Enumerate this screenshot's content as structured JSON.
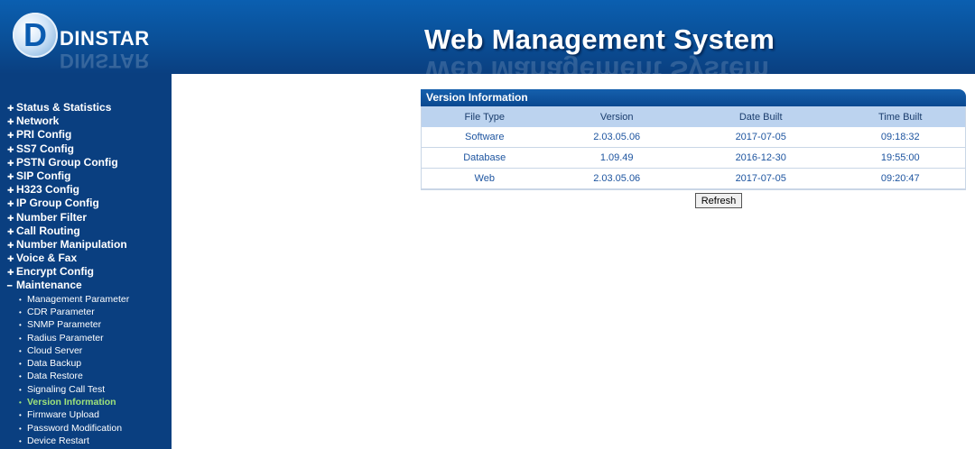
{
  "header": {
    "brand": "DINSTAR",
    "logo_letter": "D",
    "system_title": "Web Management System"
  },
  "sidebar": {
    "items": [
      {
        "label": "Status & Statistics"
      },
      {
        "label": "Network"
      },
      {
        "label": "PRI Config"
      },
      {
        "label": "SS7 Config"
      },
      {
        "label": "PSTN Group Config"
      },
      {
        "label": "SIP Config"
      },
      {
        "label": "H323 Config"
      },
      {
        "label": "IP Group Config"
      },
      {
        "label": "Number Filter"
      },
      {
        "label": "Call Routing"
      },
      {
        "label": "Number Manipulation"
      },
      {
        "label": "Voice & Fax"
      },
      {
        "label": "Encrypt Config"
      },
      {
        "label": "Maintenance"
      }
    ],
    "maintenance_sub": [
      {
        "label": "Management Parameter"
      },
      {
        "label": "CDR Parameter"
      },
      {
        "label": "SNMP Parameter"
      },
      {
        "label": "Radius Parameter"
      },
      {
        "label": "Cloud Server"
      },
      {
        "label": "Data Backup"
      },
      {
        "label": "Data Restore"
      },
      {
        "label": "Signaling Call Test"
      },
      {
        "label": "Version Information"
      },
      {
        "label": "Firmware Upload"
      },
      {
        "label": "Password Modification"
      },
      {
        "label": "Device Restart"
      }
    ],
    "active_sub": "Version Information"
  },
  "version_panel": {
    "title": "Version Information",
    "columns": [
      "File Type",
      "Version",
      "Date Built",
      "Time Built"
    ],
    "rows": [
      [
        "Software",
        "2.03.05.06",
        "2017-07-05",
        "09:18:32"
      ],
      [
        "Database",
        "1.09.49",
        "2016-12-30",
        "19:55:00"
      ],
      [
        "Web",
        "2.03.05.06",
        "2017-07-05",
        "09:20:47"
      ]
    ],
    "refresh_label": "Refresh"
  },
  "colors": {
    "header_blue": "#0a4f97",
    "sidebar_blue": "#0a3f80",
    "active_green": "#9ee37a",
    "table_header": "#bcd3ef"
  }
}
